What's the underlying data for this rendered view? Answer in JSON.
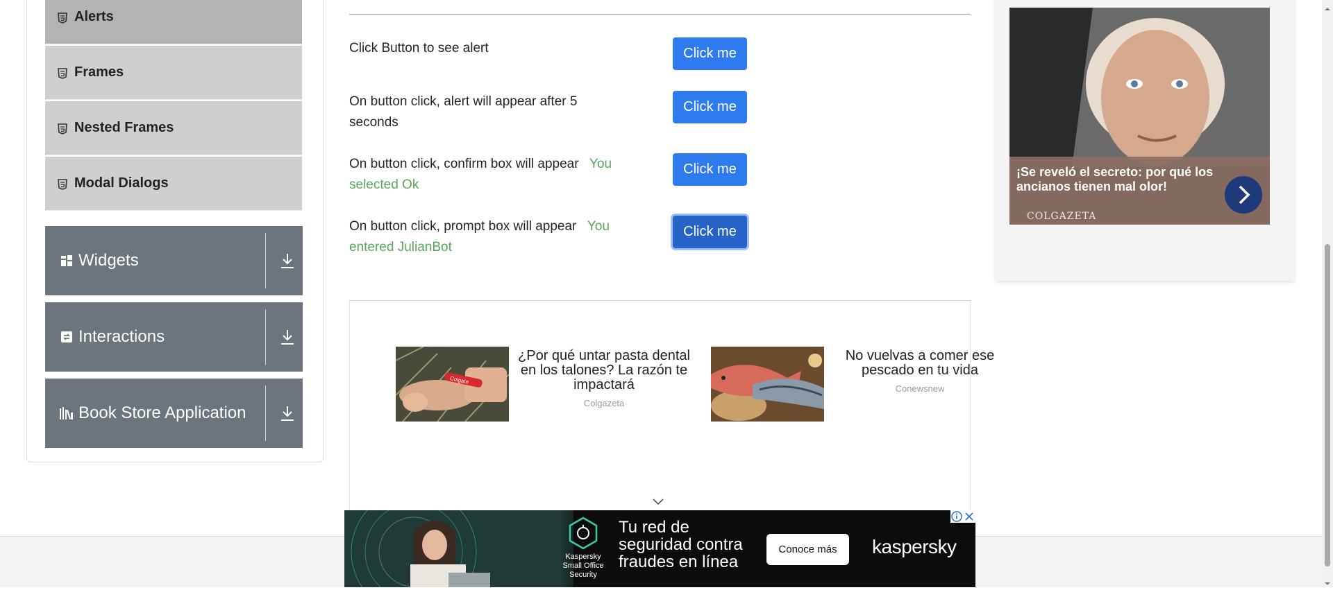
{
  "sidebar": {
    "items": [
      {
        "label": "Alerts"
      },
      {
        "label": "Frames"
      },
      {
        "label": "Nested Frames"
      },
      {
        "label": "Modal Dialogs"
      }
    ],
    "groups": [
      {
        "label": "Widgets",
        "icon": "widgets-icon"
      },
      {
        "label": "Interactions",
        "icon": "interactions-icon"
      },
      {
        "label": "Book Store Application",
        "icon": "book-store-icon"
      }
    ]
  },
  "alerts": {
    "rows": [
      {
        "label": "Click Button to see alert",
        "result": "",
        "button": "Click me"
      },
      {
        "label": "On button click, alert will appear after 5 seconds",
        "result": "",
        "button": "Click me"
      },
      {
        "label": "On button click, confirm box will appear",
        "result": "You selected Ok",
        "button": "Click me"
      },
      {
        "label": "On button click, prompt box will appear",
        "result": "You entered JulianBot",
        "button": "Click me"
      }
    ]
  },
  "ads": {
    "cards": [
      {
        "title": "¿Por qué untar pasta dental en los talones? La razón te impactará",
        "source": "Colgazeta"
      },
      {
        "title": "No vuelvas a comer ese pescado en tu vida",
        "source": "Conewsnew"
      }
    ],
    "right": {
      "headline": "¡Se reveló el secreto: por qué los ancianos tienen mal olor!",
      "source": "COLGAZETA"
    },
    "banner": {
      "brand_sub": "Kaspersky\nSmall Office\nSecurity",
      "headline": "Tu red de seguridad contra fraudes en línea",
      "cta": "Conoce más",
      "logo": "kaspersky"
    }
  },
  "colors": {
    "primary_button": "#2e7bf0",
    "result_text": "#58a55c",
    "sidebar_group": "#6c757d",
    "sidebar_item": "#cfcfcf"
  }
}
